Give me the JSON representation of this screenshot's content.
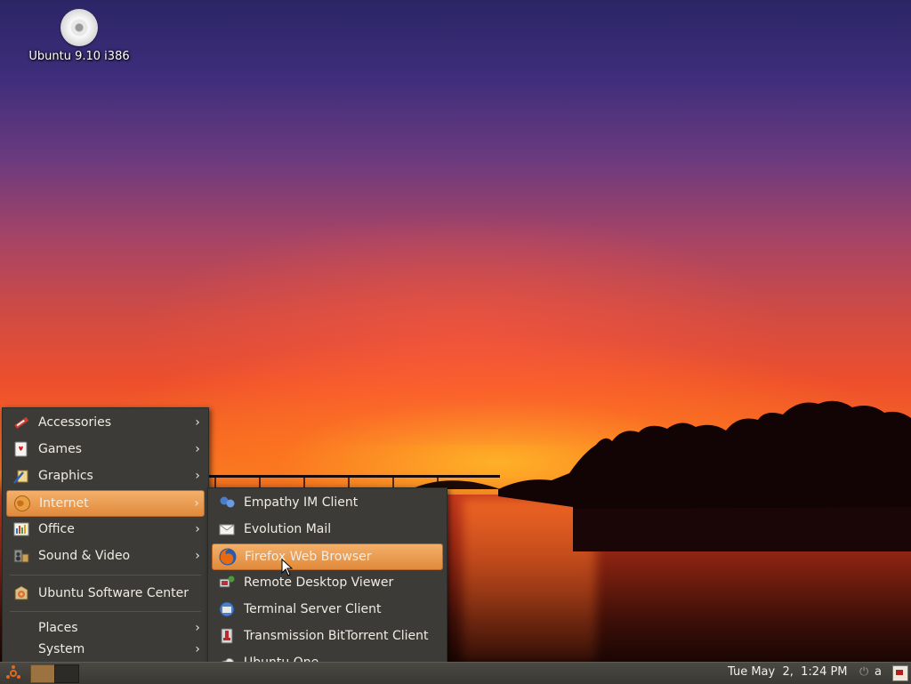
{
  "desktop": {
    "icons": [
      {
        "label": "Ubuntu 9.10 i386",
        "icon": "cdrom-icon"
      }
    ]
  },
  "applications_menu": {
    "items": [
      {
        "label": "Accessories",
        "icon": "accessories-icon",
        "has_submenu": true
      },
      {
        "label": "Games",
        "icon": "games-icon",
        "has_submenu": true
      },
      {
        "label": "Graphics",
        "icon": "graphics-icon",
        "has_submenu": true
      },
      {
        "label": "Internet",
        "icon": "internet-icon",
        "has_submenu": true,
        "active": true
      },
      {
        "label": "Office",
        "icon": "office-icon",
        "has_submenu": true
      },
      {
        "label": "Sound & Video",
        "icon": "sound-video-icon",
        "has_submenu": true
      },
      {
        "label": "Ubuntu Software Center",
        "icon": "software-center-icon",
        "has_submenu": false
      },
      {
        "label": "Places",
        "icon": "",
        "has_submenu": true
      },
      {
        "label": "System",
        "icon": "",
        "has_submenu": true
      }
    ]
  },
  "internet_submenu": {
    "items": [
      {
        "label": "Empathy IM Client",
        "icon": "empathy-icon"
      },
      {
        "label": "Evolution Mail",
        "icon": "mail-icon"
      },
      {
        "label": "Firefox Web Browser",
        "icon": "firefox-icon",
        "highlighted": true
      },
      {
        "label": "Remote Desktop Viewer",
        "icon": "remote-desktop-icon"
      },
      {
        "label": "Terminal Server Client",
        "icon": "terminal-server-icon"
      },
      {
        "label": "Transmission BitTorrent Client",
        "icon": "transmission-icon"
      },
      {
        "label": "Ubuntu One",
        "icon": "ubuntu-one-icon"
      }
    ]
  },
  "panel": {
    "clock": "Tue May  2,  1:24 PM",
    "user": "a"
  },
  "colors": {
    "menu_bg": "#3c3b37",
    "highlight": "#e89a4c",
    "panel_bg": "#3f3e39"
  }
}
